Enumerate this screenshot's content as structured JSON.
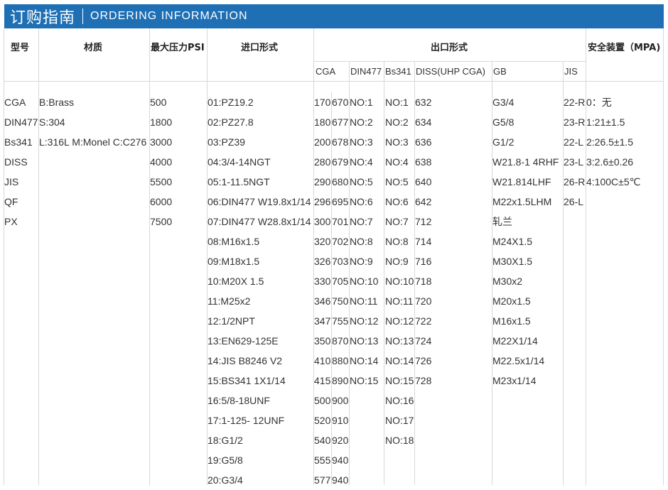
{
  "header": {
    "title": "订购指南",
    "subtitle": "ORDERING INFORMATION"
  },
  "columns": {
    "model": "型号",
    "material": "材质",
    "max_pressure": "最大压力PSI",
    "inlet": "进口形式",
    "outlet": "出口形式",
    "safety": "安全装置（MPA)"
  },
  "outlet_sub": {
    "cga": "CGA",
    "din477": "DIN477",
    "bs341": "Bs341",
    "diss": "DISS(UHP CGA)",
    "gb": "GB",
    "jis": "JIS"
  },
  "rows": {
    "model": [
      "CGA",
      "DIN477",
      "Bs341",
      "DISS",
      "JIS",
      "QF",
      "PX"
    ],
    "material": [
      "B:Brass",
      "S:304",
      "L:316L M:Monel C:C276"
    ],
    "pressure": [
      "500",
      "1800",
      "3000",
      "4000",
      "5500",
      "6000",
      "7500"
    ],
    "inlet": [
      "01:PZ19.2",
      "02:PZ27.8",
      "03:PZ39",
      "04:3/4-14NGT",
      "05:1-11.5NGT",
      "06:DIN477 W19.8x1/14",
      "07:DIN477 W28.8x1/14",
      "08:M16x1.5",
      "09:M18x1.5",
      "10:M20X 1.5",
      "11:M25x2",
      "12:1/2NPT",
      "13:EN629-125E",
      "14:JIS B8246 V2",
      "15:BS341 1X1/14",
      "16:5/8-18UNF",
      "17:1-125- 12UNF",
      "18:G1/2",
      "19:G5/8",
      "20:G3/4"
    ],
    "cga_a": [
      "170",
      "180",
      "200",
      "280",
      "290",
      "296",
      "300",
      "320",
      "326",
      "330",
      "346",
      "347",
      "350",
      "410",
      "415",
      "500",
      "520",
      "540",
      "555",
      "577"
    ],
    "cga_b": [
      "670",
      "677",
      "678",
      "679",
      "680",
      "695",
      "701",
      "702",
      "703",
      "705",
      "750",
      "755",
      "870",
      "880",
      "890",
      "900",
      "910",
      "920",
      "940",
      "940"
    ],
    "din477": [
      "NO:1",
      "NO:2",
      "NO:3",
      "NO:4",
      "NO:5",
      "NO:6",
      "NO:7",
      "NO:8",
      "NO:9",
      "NO:10",
      "NO:11",
      "NO:12",
      "NO:13",
      "NO:14",
      "NO:15"
    ],
    "bs341": [
      "NO:1",
      "NO:2",
      "NO:3",
      "NO:4",
      "NO:5",
      "NO:6",
      "NO:7",
      "NO:8",
      "NO:9",
      "NO:10",
      "NO:11",
      "NO:12",
      "NO:13",
      "NO:14",
      "NO:15",
      "NO:16",
      "NO:17",
      "NO:18"
    ],
    "diss": [
      "632",
      "634",
      "636",
      "638",
      "640",
      "642",
      "712",
      "714",
      "716",
      "718",
      "720",
      "722",
      "724",
      "726",
      "728"
    ],
    "gb": [
      "G3/4",
      "G5/8",
      "G1/2",
      " W21.8-1 4RHF",
      "W21.814LHF",
      "M22x1.5LHM",
      "轧兰",
      "M24X1.5",
      "M30X1.5",
      "M30x2",
      "M20x1.5",
      "M16x1.5",
      "M22X1/14",
      "M22.5x1/14",
      "M23x1/14"
    ],
    "jis": [
      "22-R",
      "23-R",
      "22-L",
      "23-L",
      "26-R",
      "26-L"
    ],
    "safety": [
      "0：无",
      "1:21±1.5",
      "2:26.5±1.5",
      "3:2.6±0.26",
      "4:100C±5℃"
    ]
  }
}
